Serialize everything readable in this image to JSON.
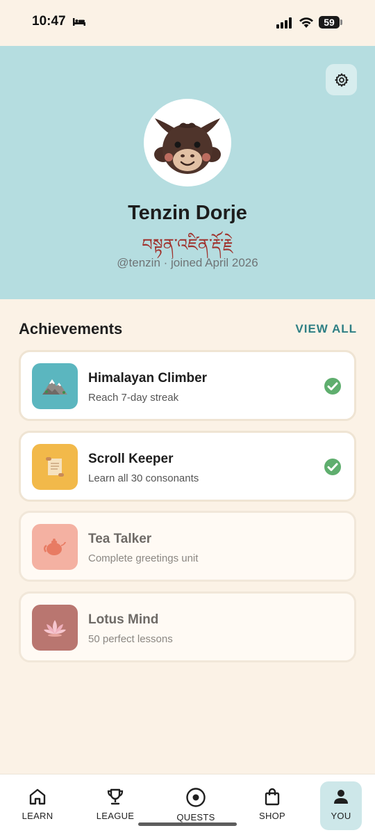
{
  "status_bar": {
    "time": "10:47",
    "battery": "59"
  },
  "profile": {
    "name": "Tenzin Dorje",
    "tibetan_name": "བསྟན་འཛིན་རྡོ་རྗེ",
    "meta": "@tenzin · joined April 2026"
  },
  "achievements": {
    "title": "Achievements",
    "view_all": "VIEW ALL",
    "items": [
      {
        "title": "Himalayan Climber",
        "subtitle": "Reach 7-day streak",
        "icon": "mountain-icon",
        "completed": true,
        "badge_color": "#5bb6bf"
      },
      {
        "title": "Scroll Keeper",
        "subtitle": "Learn all 30 consonants",
        "icon": "scroll-icon",
        "completed": true,
        "badge_color": "#f2b94a"
      },
      {
        "title": "Tea Talker",
        "subtitle": "Complete greetings unit",
        "icon": "teapot-icon",
        "completed": false,
        "badge_color": "#f4b1a2"
      },
      {
        "title": "Lotus Mind",
        "subtitle": "50 perfect lessons",
        "icon": "lotus-icon",
        "completed": false,
        "badge_color": "#b97670"
      }
    ]
  },
  "nav": {
    "items": [
      {
        "label": "LEARN",
        "icon": "home-icon",
        "active": false
      },
      {
        "label": "LEAGUE",
        "icon": "trophy-icon",
        "active": false
      },
      {
        "label": "QUESTS",
        "icon": "target-icon",
        "active": false
      },
      {
        "label": "SHOP",
        "icon": "shopping-bag-icon",
        "active": false
      },
      {
        "label": "YOU",
        "icon": "person-icon",
        "active": true
      }
    ]
  },
  "colors": {
    "header_bg": "#b5dde0",
    "page_bg": "#fbf2e6",
    "accent": "#2e7f84",
    "check": "#5fae6e",
    "tibetan_text": "#a0322d"
  }
}
